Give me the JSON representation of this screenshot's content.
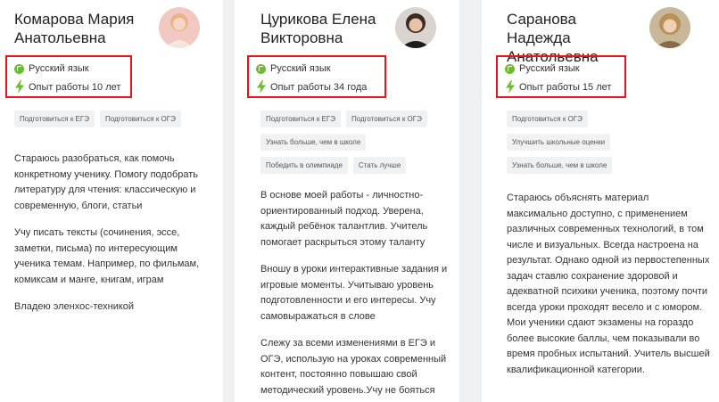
{
  "tutors": [
    {
      "name": "Комарова Мария Анатольевна",
      "subject": "Русский язык",
      "experience": "Опыт работы 10 лет",
      "tags": [
        "Подготовиться к ЕГЭ",
        "Подготовиться к ОГЭ"
      ],
      "bio": [
        "Стараюсь разобраться, как помочь конкретному ученику. Помогу подобрать литературу для чтения: классическую и современную, блоги, статьи",
        "Учу писать тексты (сочинения, эссе, заметки, письма) по интересующим ученика темам. Например, по фильмам, комиксам и манге, книгам, играм",
        "Владею эленхос-техникой"
      ]
    },
    {
      "name": "Цурикова Елена Викторовна",
      "subject": "Русский язык",
      "experience": "Опыт работы 34 года",
      "tags": [
        "Подготовиться к ЕГЭ",
        "Подготовиться к ОГЭ",
        "Узнать больше, чем в школе",
        "Победить в олимпиаде",
        "Стать лучше"
      ],
      "bio": [
        "В основе моей работы - личностно-ориентированный подход. Уверена, каждый ребёнок талантлив. Учитель помогает раскрыться этому таланту",
        "Вношу в уроки интерактивные задания и игровые моменты. Учитываю уровень подготовленности и его интересы. Учу самовыражаться в слове",
        "Слежу за всеми изменениями в ЕГЭ и ОГЭ, использую на уроках современный контент, постоянно повышаю свой методический уровень.Учу не бояться"
      ]
    },
    {
      "name": "Саранова Надежда Анатольевна",
      "subject": "Русский язык",
      "experience": "Опыт работы 15 лет",
      "tags": [
        "Подготовиться к ОГЭ",
        "Улучшить школьные оценки",
        "Узнать больше, чем в школе"
      ],
      "bio": [
        "Стараюсь объяснять материал максимально доступно, с применением различных современных технологий, в том числе и визуальных. Всегда настроена на результат. Однако одной из первостепенных задач ставлю сохранение здоровой и адекватной психики ученика, поэтому почти всегда уроки проходят весело и с юмором. Мои ученики сдают экзамены на гораздо более высокие баллы, чем показывали во время пробных испытаний. Учитель высшей квалификационной категории."
      ]
    }
  ],
  "colors": {
    "highlight_border": "#e8131b",
    "accent_green": "#6dbb2f",
    "tag_background": "#f0f1f3"
  },
  "icons": {
    "subject": "green-circle-subject-icon",
    "experience": "green-lightning-bolt-icon"
  }
}
